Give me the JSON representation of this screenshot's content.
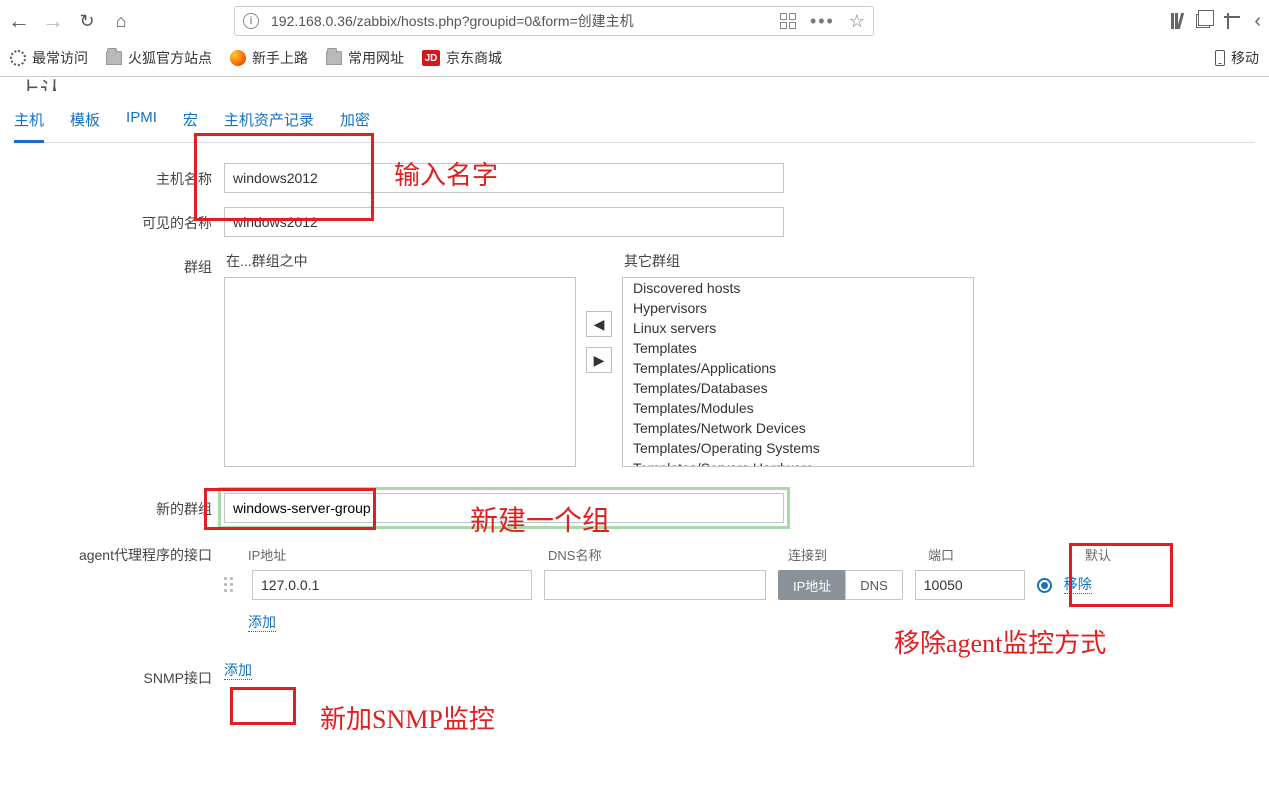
{
  "browser": {
    "url": "192.168.0.36/zabbix/hosts.php?groupid=0&form=创建主机",
    "bookmarks": {
      "most_visited": "最常访问",
      "firefox_official": "火狐官方站点",
      "getting_started": "新手上路",
      "common_urls": "常用网址",
      "jd": "京东商城",
      "mobile": "移动"
    }
  },
  "page": {
    "title_partial": "上认",
    "tabs": {
      "host": "主机",
      "templates": "模板",
      "ipmi": "IPMI",
      "macros": "宏",
      "inventory": "主机资产记录",
      "encryption": "加密"
    },
    "form": {
      "host_name_label": "主机名称",
      "host_name_value": "windows2012",
      "visible_name_label": "可见的名称",
      "visible_name_value": "windows2012",
      "groups_label": "群组",
      "in_groups_title": "在...群组之中",
      "other_groups_title": "其它群组",
      "other_groups_items": [
        "Discovered hosts",
        "Hypervisors",
        "Linux servers",
        "Templates",
        "Templates/Applications",
        "Templates/Databases",
        "Templates/Modules",
        "Templates/Network Devices",
        "Templates/Operating Systems",
        "Templates/Servers Hardware"
      ],
      "new_group_label": "新的群组",
      "new_group_value": "windows-server-group",
      "agent_iface_label": "agent代理程序的接口",
      "iface_headers": {
        "ip": "IP地址",
        "dns": "DNS名称",
        "connect_to": "连接到",
        "port": "端口",
        "default": "默认"
      },
      "iface_row": {
        "ip": "127.0.0.1",
        "dns": "",
        "btn_ip": "IP地址",
        "btn_dns": "DNS",
        "port": "10050",
        "remove": "移除"
      },
      "add_link": "添加",
      "snmp_iface_label": "SNMP接口"
    },
    "annotations": {
      "enter_name": "输入名字",
      "new_group": "新建一个组",
      "remove_agent": "移除agent监控方式",
      "add_snmp": "新加SNMP监控"
    }
  }
}
